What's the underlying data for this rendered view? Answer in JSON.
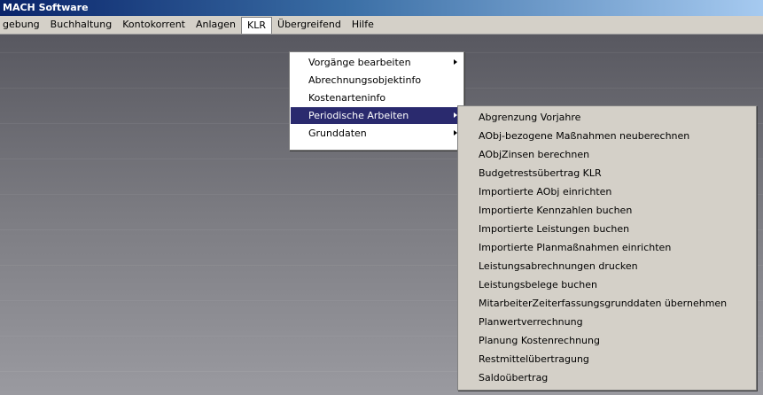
{
  "window": {
    "title": "MACH Software"
  },
  "menubar": {
    "items": [
      {
        "label": "gebung"
      },
      {
        "label": "Buchhaltung"
      },
      {
        "label": "Kontokorrent"
      },
      {
        "label": "Anlagen"
      },
      {
        "label": "KLR"
      },
      {
        "label": "Übergreifend"
      },
      {
        "label": "Hilfe"
      }
    ],
    "open_item": "KLR"
  },
  "klr_menu": {
    "items": [
      {
        "label": "Vorgänge bearbeiten",
        "submenu": true
      },
      {
        "label": "Abrechnungsobjektinfo",
        "submenu": false
      },
      {
        "label": "Kostenarteninfo",
        "submenu": false
      },
      {
        "label": "Periodische Arbeiten",
        "submenu": true,
        "highlighted": true
      },
      {
        "label": "Grunddaten",
        "submenu": true
      }
    ]
  },
  "periodic_submenu": {
    "items": [
      {
        "label": "Abgrenzung Vorjahre"
      },
      {
        "label": "AObj-bezogene Maßnahmen neuberechnen"
      },
      {
        "label": "AObjZinsen berechnen"
      },
      {
        "label": "Budgetrestsübertrag KLR"
      },
      {
        "label": "Importierte AObj einrichten"
      },
      {
        "label": "Importierte Kennzahlen buchen"
      },
      {
        "label": "Importierte Leistungen buchen"
      },
      {
        "label": "Importierte Planmaßnahmen einrichten"
      },
      {
        "label": "Leistungsabrechnungen drucken"
      },
      {
        "label": "Leistungsbelege buchen"
      },
      {
        "label": "MitarbeiterZeiterfassungsgrunddaten übernehmen"
      },
      {
        "label": "Planwertverrechnung"
      },
      {
        "label": "Planung Kostenrechnung"
      },
      {
        "label": "Restmittelübertragung"
      },
      {
        "label": "Saldoübertrag"
      }
    ]
  },
  "colors": {
    "highlight": "#2a2a6e",
    "menu_bg": "#d4d0c8",
    "titlebar": "#0a246a"
  }
}
